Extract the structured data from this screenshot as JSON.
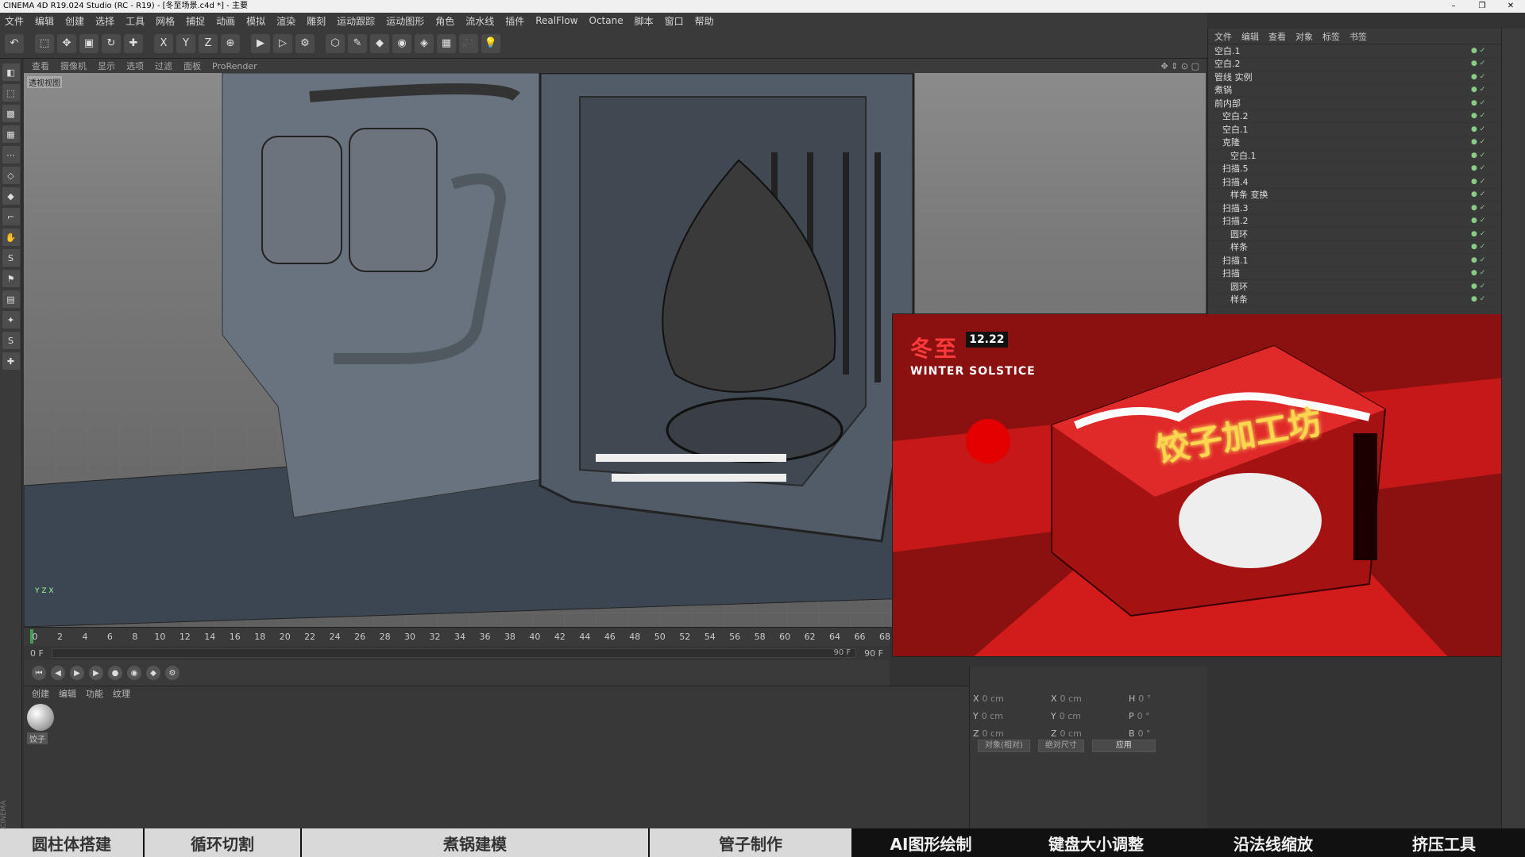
{
  "window": {
    "title": "CINEMA 4D R19.024 Studio (RC - R19) - [冬至场景.c4d *] - 主要",
    "buttons": [
      "–",
      "❐",
      "✕"
    ]
  },
  "menu": [
    "文件",
    "编辑",
    "创建",
    "选择",
    "工具",
    "网格",
    "捕捉",
    "动画",
    "模拟",
    "渲染",
    "雕刻",
    "运动跟踪",
    "运动图形",
    "角色",
    "流水线",
    "插件",
    "RealFlow",
    "Octane",
    "脚本",
    "窗口",
    "帮助"
  ],
  "toolbar": {
    "icons": [
      "undo-icon",
      "select-icon",
      "move-icon",
      "scale-icon",
      "rotate-icon",
      "add-icon",
      "x-axis-icon",
      "y-axis-icon",
      "z-axis-icon",
      "world-icon",
      "render-view-icon",
      "render-icon",
      "render-settings-icon",
      "cube-icon",
      "pen-icon",
      "subdiv-icon",
      "array-icon",
      "deformer-icon",
      "floor-icon",
      "camera-icon",
      "light-icon"
    ],
    "glyphs": [
      "↶",
      "⬚",
      "✥",
      "▣",
      "↻",
      "✚",
      "X",
      "Y",
      "Z",
      "⊕",
      "▶",
      "▷",
      "⚙",
      "⬡",
      "✎",
      "◆",
      "◉",
      "◈",
      "▦",
      "🎥",
      "💡"
    ]
  },
  "viewport": {
    "menu": [
      "查看",
      "摄像机",
      "显示",
      "选项",
      "过滤",
      "面板",
      "ProRender"
    ],
    "label": "透视视图",
    "axis": "Y\nZ X"
  },
  "render_preview": {
    "badge_cn": "冬至",
    "date": "12.22",
    "subtitle": "WINTER SOLSTICE",
    "shop_name": "饺子加工坊"
  },
  "object_manager": {
    "menu": [
      "文件",
      "编辑",
      "查看",
      "对象",
      "标签",
      "书签"
    ],
    "rows": [
      "空白.1",
      "空白.2",
      "管线 实例",
      "煮锅",
      "前内部",
      "空白.2",
      "空白.1",
      "克隆",
      "空白.1",
      "扫描.5",
      "扫描.4",
      "样条 变换",
      "扫描.3",
      "扫描.2",
      "圆环",
      "样条",
      "扫描.1",
      "扫描",
      "圆环",
      "样条"
    ]
  },
  "timeline": {
    "ticks": [
      "0",
      "2",
      "4",
      "6",
      "8",
      "10",
      "12",
      "14",
      "16",
      "18",
      "20",
      "22",
      "24",
      "26",
      "28",
      "30",
      "32",
      "34",
      "36",
      "38",
      "40",
      "42",
      "44",
      "46",
      "48",
      "50",
      "52",
      "54",
      "56",
      "58",
      "60",
      "62",
      "64",
      "66",
      "68"
    ],
    "current": "0 F",
    "start": "0 F",
    "end": "90 F",
    "end2": "90 F"
  },
  "materials": {
    "menu": [
      "创建",
      "编辑",
      "功能",
      "纹理"
    ],
    "material_name": "饺子"
  },
  "coordinates": {
    "pos": [
      {
        "axis": "X",
        "val": "0 cm"
      },
      {
        "axis": "Y",
        "val": "0 cm"
      },
      {
        "axis": "Z",
        "val": "0 cm"
      }
    ],
    "size": [
      {
        "axis": "X",
        "val": "0 cm"
      },
      {
        "axis": "Y",
        "val": "0 cm"
      },
      {
        "axis": "Z",
        "val": "0 cm"
      }
    ],
    "rot": [
      {
        "axis": "H",
        "val": "0 °"
      },
      {
        "axis": "P",
        "val": "0 °"
      },
      {
        "axis": "B",
        "val": "0 °"
      }
    ],
    "mode1": "对象(相对)",
    "mode2": "绝对尺寸",
    "apply": "应用"
  },
  "brand_side": "MAXON CINEMA 4D",
  "lesson_tags": [
    {
      "label": "圆柱体搭建",
      "style": "light"
    },
    {
      "label": "循环切割",
      "style": "light"
    },
    {
      "label": "煮锅建模",
      "style": "light"
    },
    {
      "label": "管子制作",
      "style": "light"
    },
    {
      "label": "AI图形绘制",
      "style": "dark"
    },
    {
      "label": "键盘大小调整",
      "style": "dark"
    },
    {
      "label": "沿法线缩放",
      "style": "dark"
    },
    {
      "label": "挤压工具",
      "style": "dark"
    }
  ],
  "colors": {
    "accent_green": "#3f9e4f",
    "render_red": "#c61818",
    "ui_dark": "#3a3a3a"
  }
}
